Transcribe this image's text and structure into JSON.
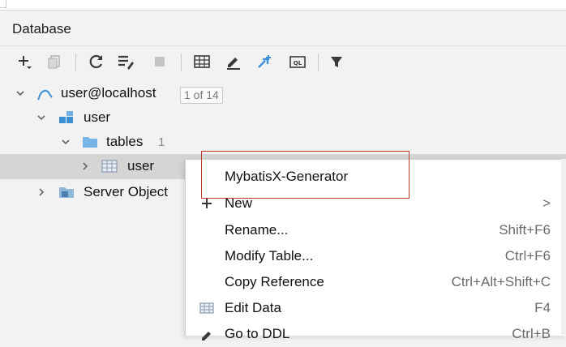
{
  "panel": {
    "title": "Database"
  },
  "toolbar": {
    "icons": [
      "add-icon",
      "duplicate-icon",
      "refresh-icon",
      "data-source-properties-icon",
      "stop-icon",
      "table-view-icon",
      "edit-icon",
      "jump-to-source-icon",
      "query-console-icon",
      "filter-icon"
    ]
  },
  "tree": {
    "datasource": {
      "label": "user@localhost",
      "badge": "1 of 14"
    },
    "schema": {
      "label": "user"
    },
    "tables": {
      "label": "tables",
      "count": "1"
    },
    "table": {
      "label": "user"
    },
    "server_objects": {
      "label": "Server Object"
    }
  },
  "context_menu": {
    "items": [
      {
        "label": "MybatisX-Generator",
        "shortcut": ""
      },
      {
        "label": "New",
        "shortcut": ">"
      },
      {
        "label": "Rename...",
        "shortcut": "Shift+F6"
      },
      {
        "label": "Modify Table...",
        "shortcut": "Ctrl+F6"
      },
      {
        "label": "Copy Reference",
        "shortcut": "Ctrl+Alt+Shift+C"
      },
      {
        "label": "Edit Data",
        "shortcut": "F4"
      },
      {
        "label": "Go to DDL",
        "shortcut": "Ctrl+B"
      }
    ]
  },
  "colors": {
    "accent_blue": "#3d8fd6",
    "folder": "#77b4e8",
    "highlight_border": "#c0392b",
    "selected_row": "#d5d5d5"
  }
}
